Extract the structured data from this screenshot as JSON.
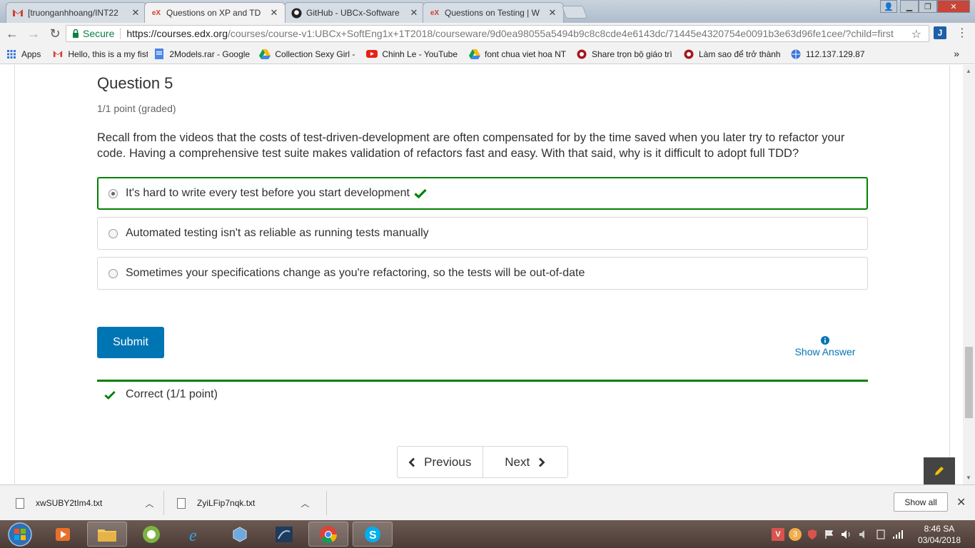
{
  "browser": {
    "tabs": [
      {
        "label": "[truonganhhoang/INT22",
        "favicon": "gmail-icon",
        "active": false
      },
      {
        "label": "Questions on XP and TD",
        "favicon": "edx-icon",
        "active": true
      },
      {
        "label": "GitHub - UBCx-Software",
        "favicon": "github-icon",
        "active": false
      },
      {
        "label": "Questions on Testing | W",
        "favicon": "edx-icon",
        "active": false
      }
    ],
    "address": {
      "secure_label": "Secure",
      "url_host": "https://courses.edx.org",
      "url_path": "/courses/course-v1:UBCx+SoftEng1x+1T2018/courseware/9d0ea98055a5494b9c8c8cde4e6143dc/71445e4320754e0091b3e63d96fe1cee/?child=first"
    },
    "bookmarks": [
      {
        "label": "Apps",
        "icon": "apps-grid-icon"
      },
      {
        "label": "Hello, this is a my fist",
        "icon": "gmail-icon"
      },
      {
        "label": "2Models.rar - Google",
        "icon": "doc-icon"
      },
      {
        "label": "Collection Sexy Girl -",
        "icon": "drive-icon"
      },
      {
        "label": "Chinh Le - YouTube",
        "icon": "youtube-icon"
      },
      {
        "label": "font chua viet hoa NT",
        "icon": "drive-icon"
      },
      {
        "label": "Share trọn bộ giáo trì",
        "icon": "site-icon"
      },
      {
        "label": "Làm sao để trở thành",
        "icon": "site-icon"
      },
      {
        "label": "112.137.129.87",
        "icon": "globe-icon"
      }
    ],
    "bookmarks_more": "»"
  },
  "question": {
    "title": "Question 5",
    "points": "1/1 point (graded)",
    "text": "Recall from the videos that the costs of test-driven-development are often compensated for by the time saved when you later try to refactor your code. Having a comprehensive test suite makes validation of refactors fast and easy. With that said, why is it difficult to adopt full TDD?",
    "choices": [
      {
        "label": "It's hard to write every test before you start development",
        "selected": true,
        "correct": true
      },
      {
        "label": "Automated testing isn't as reliable as running tests manually",
        "selected": false,
        "correct": false
      },
      {
        "label": "Sometimes your specifications change as you're refactoring, so the tests will be out-of-date",
        "selected": false,
        "correct": false
      }
    ],
    "submit_label": "Submit",
    "show_answer_label": "Show Answer",
    "status": "Correct (1/1 point)"
  },
  "sequence_nav": {
    "previous_label": "Previous",
    "next_label": "Next"
  },
  "downloads": {
    "items": [
      {
        "filename": "xwSUBY2tIm4.txt"
      },
      {
        "filename": "ZyiLFip7nqk.txt"
      }
    ],
    "show_all_label": "Show all"
  },
  "taskbar": {
    "clock_time": "8:46 SA",
    "clock_date": "03/04/2018"
  },
  "colors": {
    "accent": "#0075b4",
    "correct": "#008100"
  }
}
